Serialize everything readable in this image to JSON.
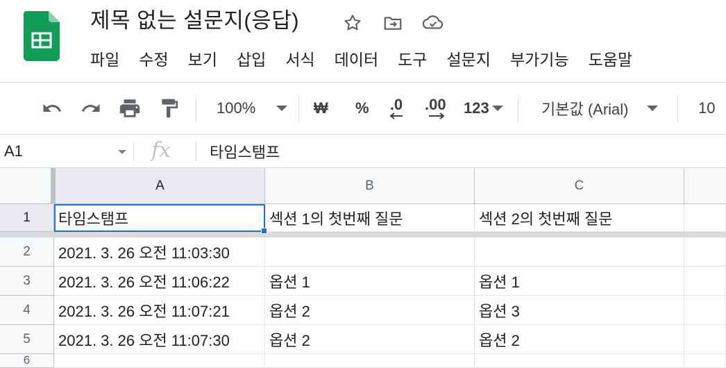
{
  "document": {
    "title": "제목 없는 설문지(응답)",
    "brand_color": "#0f9d58"
  },
  "title_icons": [
    "star-icon",
    "move-to-folder-icon",
    "cloud-saved-icon"
  ],
  "menu": [
    "파일",
    "수정",
    "보기",
    "삽입",
    "서식",
    "데이터",
    "도구",
    "설문지",
    "부가기능",
    "도움말"
  ],
  "toolbar": {
    "zoom": "100%",
    "currency": "₩",
    "percent": "%",
    "decrease_decimal": ".0",
    "increase_decimal": ".00",
    "more_formats": "123",
    "font": "기본값 (Arial)",
    "font_size": "10"
  },
  "formula_bar": {
    "cell_ref": "A1",
    "fx": "fx",
    "value": "타임스탬프"
  },
  "sheet": {
    "columns": [
      "A",
      "B",
      "C"
    ],
    "selected_cell": "A1",
    "rows": [
      {
        "num": "1",
        "a": "타임스탬프",
        "b": "섹션 1의 첫번째 질문",
        "c": "섹션 2의 첫번째 질문"
      },
      {
        "num": "2",
        "a": "2021. 3. 26 오전 11:03:30",
        "b": "",
        "c": ""
      },
      {
        "num": "3",
        "a": "2021. 3. 26 오전 11:06:22",
        "b": "옵션 1",
        "c": "옵션 1"
      },
      {
        "num": "4",
        "a": "2021. 3. 26 오전 11:07:21",
        "b": "옵션 2",
        "c": "옵션 3"
      },
      {
        "num": "5",
        "a": "2021. 3. 26 오전 11:07:30",
        "b": "옵션 2",
        "c": "옵션 2"
      },
      {
        "num": "6",
        "a": "",
        "b": "",
        "c": ""
      }
    ]
  }
}
